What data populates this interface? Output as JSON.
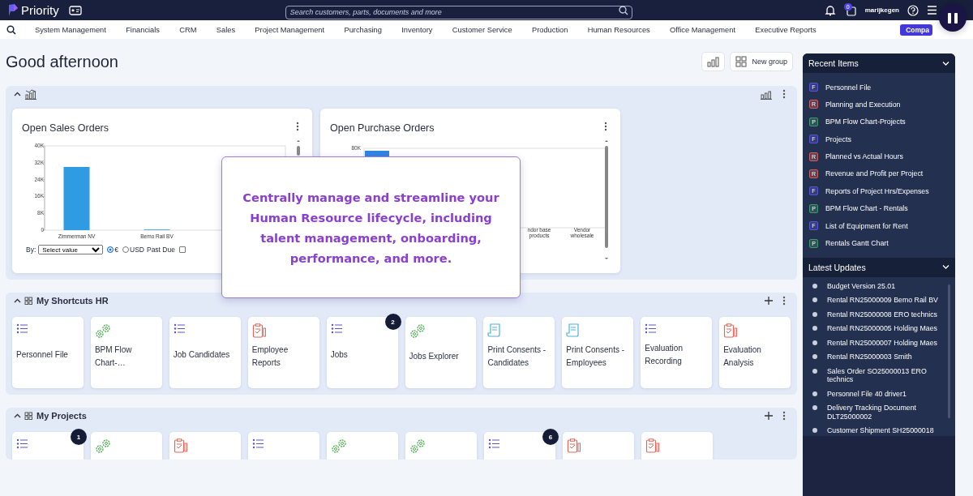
{
  "topbar": {
    "brand": "Priority",
    "search": {
      "placeholder": "Search customers, parts, documents and more"
    },
    "notification_count": "0",
    "user": "marijkegen"
  },
  "menu": {
    "items": [
      "System Management",
      "Financials",
      "CRM",
      "Sales",
      "Project Management",
      "Purchasing",
      "Inventory",
      "Customer Service",
      "Production",
      "Human Resources",
      "Office Management",
      "Executive Reports"
    ],
    "company_button": "Compa"
  },
  "greeting": "Good afternoon",
  "toolbar": {
    "new_group": "New group"
  },
  "chart_section": {
    "expanded": true,
    "cards": [
      {
        "kind": "sales",
        "title": "Open Sales Orders",
        "chart_data": {
          "type": "bar",
          "categories": [
            "Zimmerman NV",
            "Bemo Rail BV"
          ],
          "series": [
            {
              "color": "#2f9be3",
              "values": [
                30000,
                300
              ]
            }
          ],
          "ylim": [
            0,
            40000
          ],
          "yticks": [
            {
              "value": 0,
              "label": "0"
            },
            {
              "value": 8000,
              "label": "8K"
            },
            {
              "value": 16000,
              "label": "16K"
            },
            {
              "value": 24000,
              "label": "24K"
            },
            {
              "value": 32000,
              "label": "32K"
            },
            {
              "value": 40000,
              "label": "40K"
            }
          ]
        },
        "filter": {
          "label": "By:",
          "select": "Select value",
          "currency_options": [
            {
              "label": "€",
              "selected": true
            },
            {
              "label": "USD",
              "selected": false
            }
          ],
          "past_due": {
            "label": "Past Due",
            "checked": false
          }
        }
      },
      {
        "kind": "purchase",
        "title": "Open Purchase Orders",
        "axis_label": "80K",
        "x_labels": [
          "ndor base products",
          "Vendor wholesale"
        ]
      }
    ]
  },
  "popup": {
    "message": "Centrally manage and streamline your Human Resource lifecycle, including talent management, onboarding, performance, and more."
  },
  "shortcut_sections": [
    {
      "title": "My Shortcuts HR",
      "expanded": true,
      "tiles": [
        {
          "kind": "list",
          "label": "Personnel File"
        },
        {
          "kind": "gears",
          "label": "BPM Flow Chart-…"
        },
        {
          "kind": "list",
          "label": "Job Candidates"
        },
        {
          "kind": "report",
          "label": "Employee Reports"
        },
        {
          "kind": "list",
          "label": "Jobs",
          "badge": "2"
        },
        {
          "kind": "gears",
          "label": "Jobs Explorer"
        },
        {
          "kind": "scroll",
          "label": "Print Consents - Candidates"
        },
        {
          "kind": "scroll",
          "label": "Print Consents - Employees"
        },
        {
          "kind": "list",
          "label": "Evaluation Recording"
        },
        {
          "kind": "report",
          "label": "Evaluation Analysis"
        }
      ]
    },
    {
      "title": "My Projects",
      "expanded": true,
      "tiles": [
        {
          "kind": "list",
          "badge": "1"
        },
        {
          "kind": "gears"
        },
        {
          "kind": "report"
        },
        {
          "kind": "list"
        },
        {
          "kind": "gears"
        },
        {
          "kind": "gears"
        },
        {
          "kind": "list",
          "badge": "6"
        },
        {
          "kind": "report"
        },
        {
          "kind": "report"
        }
      ]
    }
  ],
  "sidebar": {
    "recent": {
      "title": "Recent Items",
      "expanded": true,
      "items": [
        {
          "letter": "F",
          "color": "#5b55d8",
          "label": "Personnel File"
        },
        {
          "letter": "R",
          "color": "#d0605a",
          "label": "Planning and Execution"
        },
        {
          "letter": "P",
          "color": "#3f9a6a",
          "label": "BPM Flow Chart-Projects"
        },
        {
          "letter": "F",
          "color": "#5b55d8",
          "label": "Projects"
        },
        {
          "letter": "R",
          "color": "#d0605a",
          "label": "Planned vs Actual Hours"
        },
        {
          "letter": "R",
          "color": "#d0605a",
          "label": "Revenue and Profit per Project"
        },
        {
          "letter": "F",
          "color": "#5b55d8",
          "label": "Reports of Project Hrs/Expenses"
        },
        {
          "letter": "P",
          "color": "#3f9a6a",
          "label": "BPM Flow Chart - Rentals"
        },
        {
          "letter": "F",
          "color": "#5b55d8",
          "label": "List of Equipment for Rent"
        },
        {
          "letter": "P",
          "color": "#3f9a6a",
          "label": "Rentals Gantt Chart"
        }
      ]
    },
    "updates": {
      "title": "Latest Updates",
      "expanded": true,
      "items": [
        "Budget Version 25.01",
        "Rental RN25000009 Bemo Rail BV",
        "Rental RN25000008 ERO technics",
        "Rental RN25000005 Holding Maes",
        "Rental RN25000007 Holding Maes",
        "Rental RN25000003 Smith",
        "Sales Order SO25000013 ERO technics",
        "Personnel File 40 driver1",
        "Delivery Tracking Document DLT25000002",
        "Customer Shipment SH25000018"
      ]
    }
  }
}
